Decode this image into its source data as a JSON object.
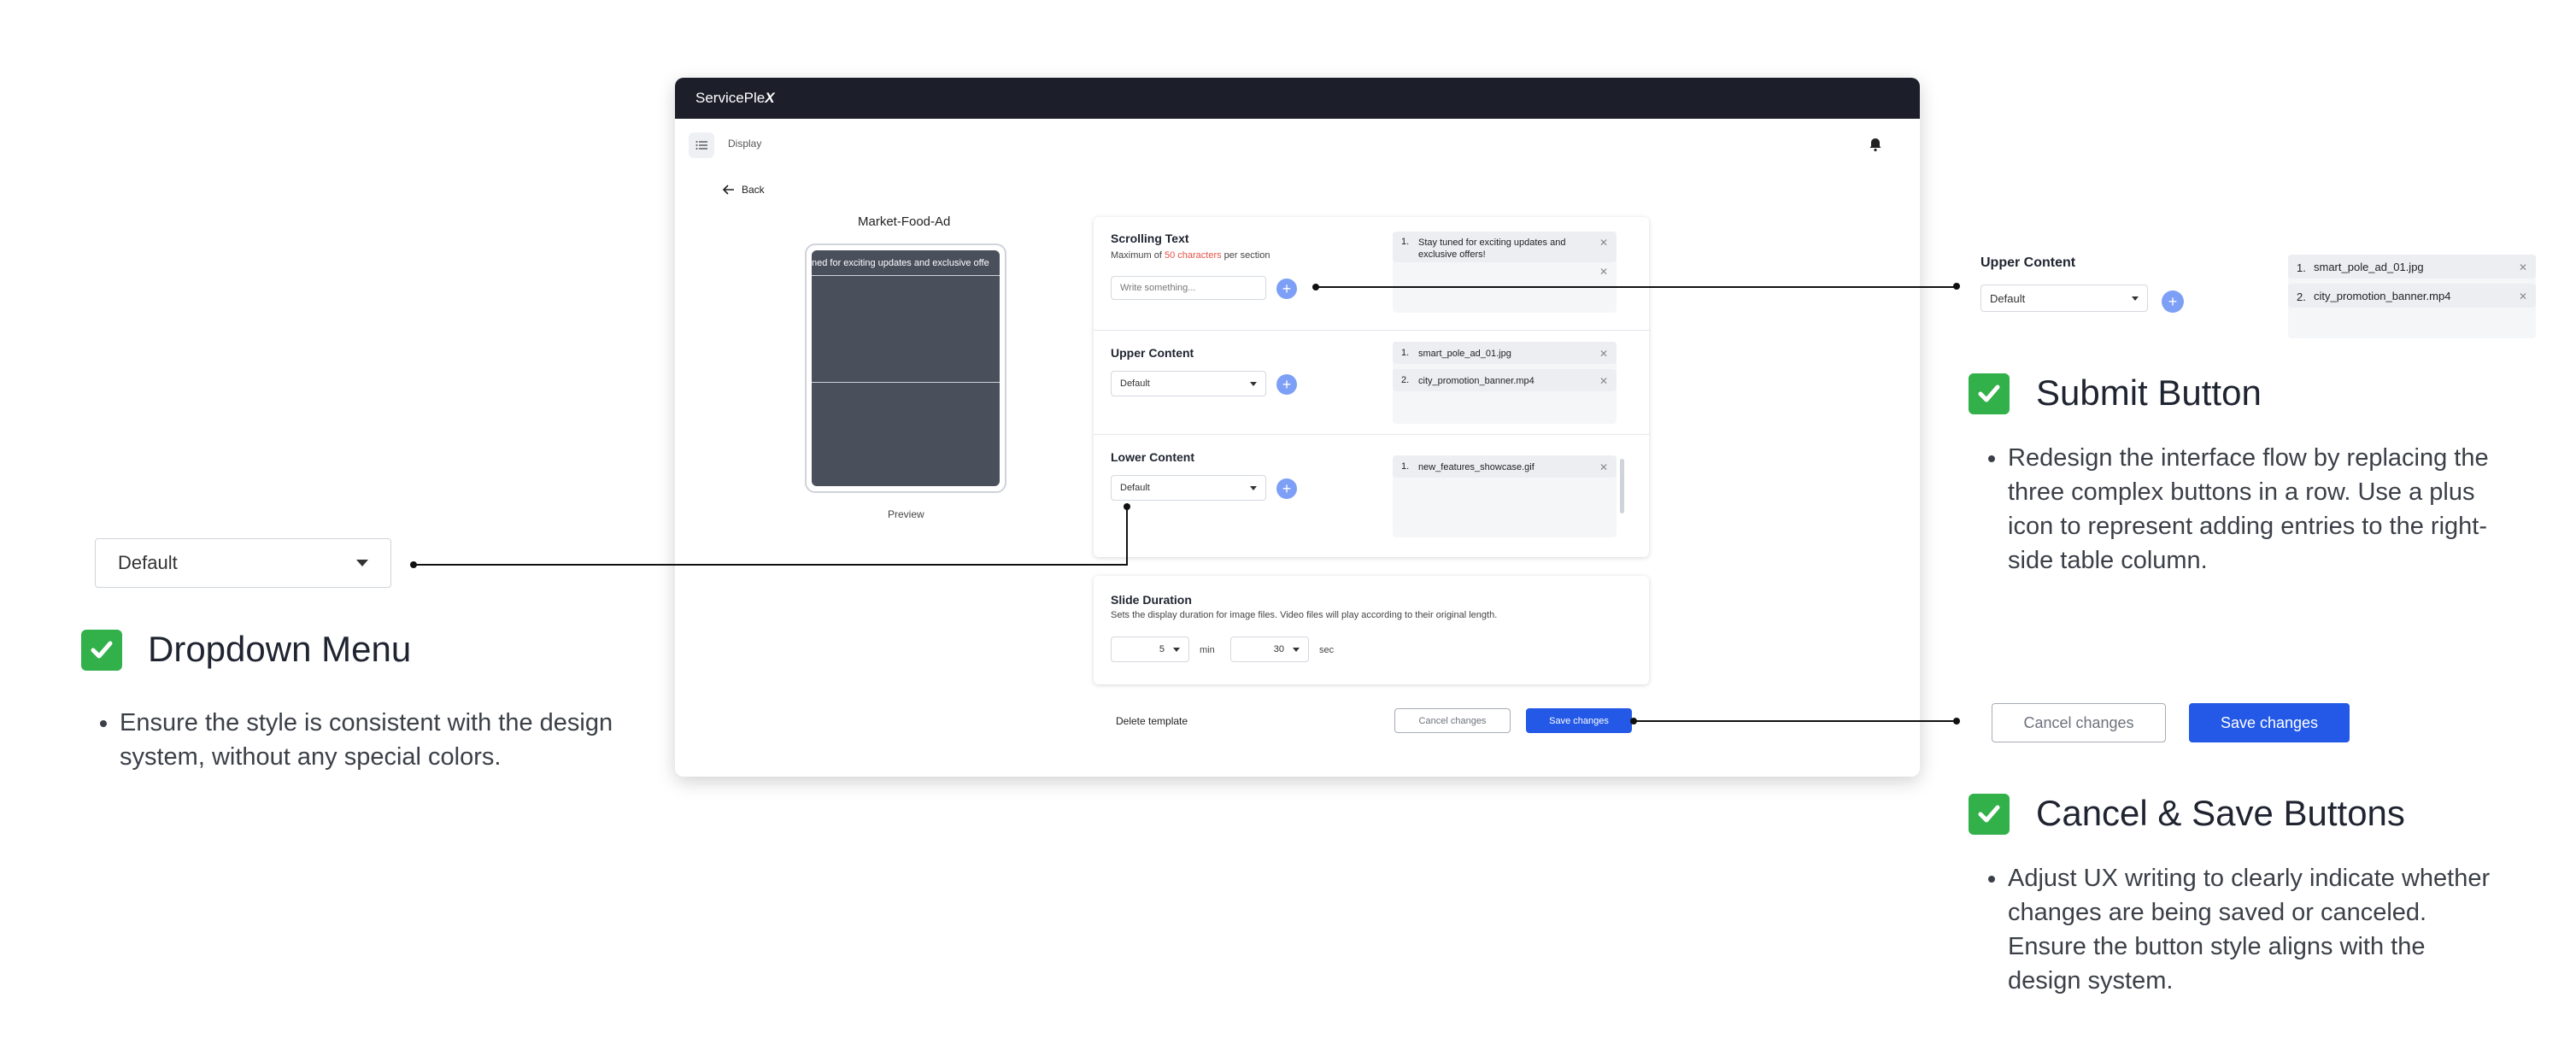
{
  "app": {
    "brand": "ServicePle",
    "brand_x": "X",
    "breadcrumb": "Display",
    "back_label": "Back",
    "ad_title": "Market-Food-Ad",
    "marquee_text": "ned for exciting updates and exclusive offe",
    "preview_label": "Preview"
  },
  "scrolling": {
    "title": "Scrolling Text",
    "sub_pre": "Maximum of ",
    "sub_highlight": "50 characters",
    "sub_post": " per section",
    "placeholder": "Write something...",
    "items": [
      {
        "num": "1.",
        "text": "Stay tuned for exciting updates and exclusive offers!"
      }
    ]
  },
  "upper": {
    "title": "Upper Content",
    "dropdown": "Default",
    "items": [
      {
        "num": "1.",
        "text": "smart_pole_ad_01.jpg"
      },
      {
        "num": "2.",
        "text": "city_promotion_banner.mp4"
      }
    ]
  },
  "lower": {
    "title": "Lower Content",
    "dropdown": "Default",
    "items": [
      {
        "num": "1.",
        "text": "new_features_showcase.gif"
      }
    ]
  },
  "slide": {
    "title": "Slide Duration",
    "sub": "Sets the display duration for image files. Video files will play according to their original length.",
    "min_value": "5",
    "min_label": "min",
    "sec_value": "30",
    "sec_label": "sec"
  },
  "footer": {
    "delete_label": "Delete template",
    "cancel_label": "Cancel changes",
    "save_label": "Save changes"
  },
  "annotations": {
    "dropdown": {
      "sample_value": "Default",
      "title": "Dropdown Menu",
      "body": "Ensure the style is consistent with the design system, without any special colors."
    },
    "submit": {
      "sample_title": "Upper Content",
      "sample_dropdown": "Default",
      "sample_items": [
        {
          "num": "1.",
          "text": "smart_pole_ad_01.jpg"
        },
        {
          "num": "2.",
          "text": "city_promotion_banner.mp4"
        }
      ],
      "title": "Submit Button",
      "body": "Redesign the interface flow by replacing the three complex buttons in a row. Use a plus icon to represent adding entries to the right-side table column."
    },
    "cancel_save": {
      "cancel_label": "Cancel changes",
      "save_label": "Save changes",
      "title": "Cancel & Save Buttons",
      "body": "Adjust UX writing to clearly indicate whether changes are being saved or canceled. Ensure the button style aligns with the design system."
    }
  },
  "colors": {
    "topbar": "#1c1f2a",
    "primary": "#2359e6",
    "plus": "#7d9ff5",
    "highlight_red": "#e55347",
    "check_green": "#32b04a"
  }
}
